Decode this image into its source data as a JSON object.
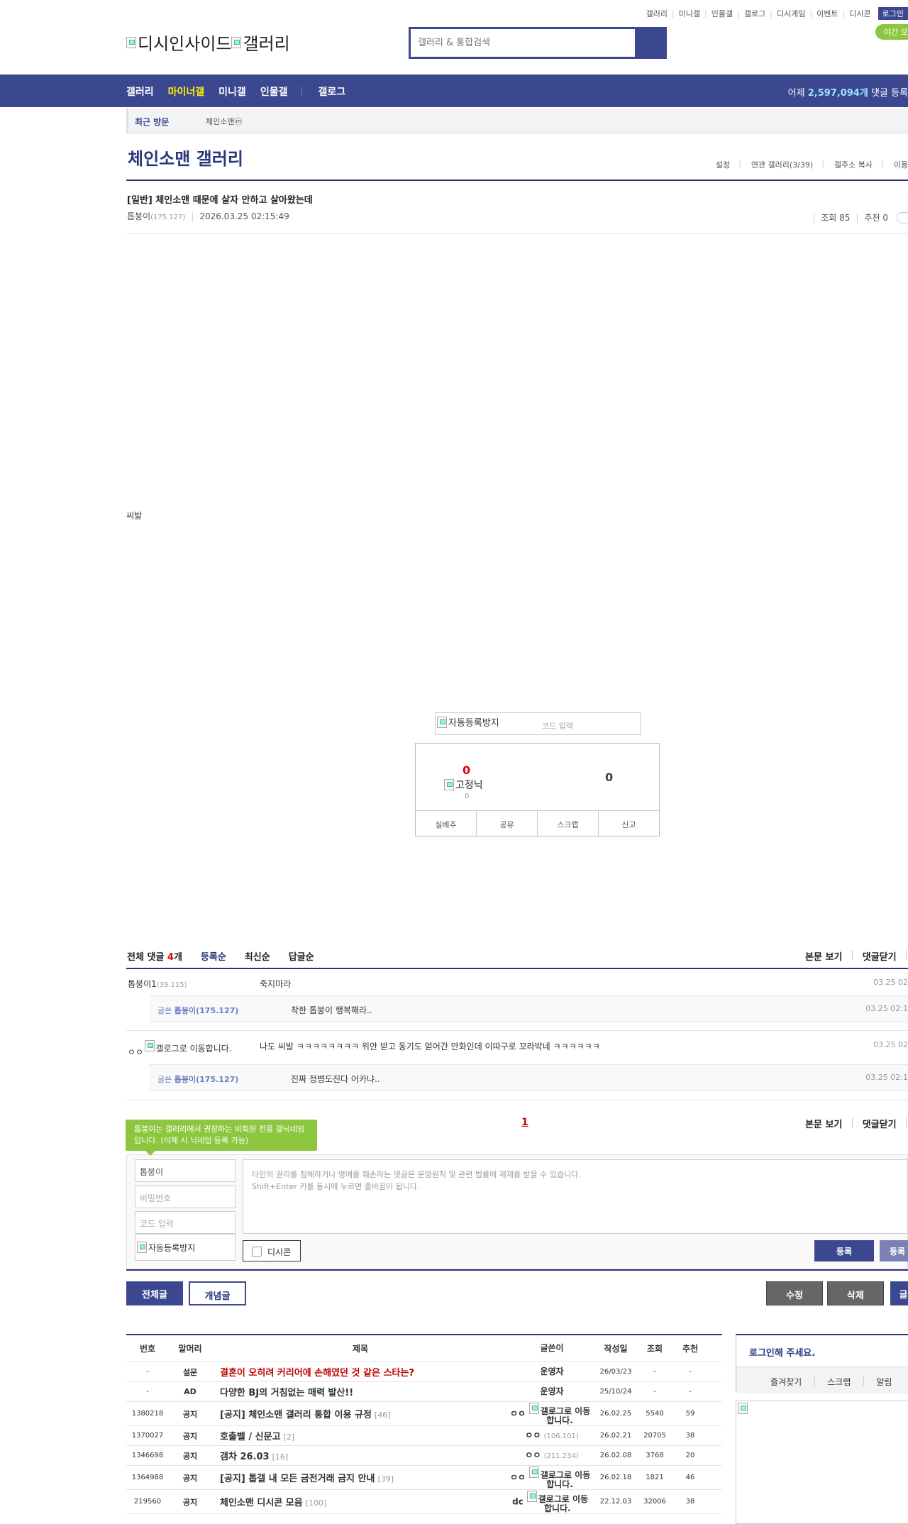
{
  "util": {
    "links": [
      "갤러리",
      "미니갤",
      "인물갤",
      "갤로그",
      "디시게임",
      "이벤트",
      "디시콘"
    ],
    "login": "로그인",
    "night": "야간 모"
  },
  "logo": {
    "alt1": "디시인사이드",
    "alt2": "갤러리"
  },
  "search": {
    "placeholder": "갤러리 & 통합검색"
  },
  "nav": {
    "items": [
      "갤러리",
      "마이너갤",
      "미니갤",
      "인물갤",
      "갤로그"
    ],
    "stat_prefix": "어제 ",
    "stat_count": "2,597,094개",
    "stat_suffix": " 댓글 등록"
  },
  "recent": {
    "title": "최근 방문",
    "item": "체인소맨ⓜ"
  },
  "gallery": {
    "title": "체인소맨 갤러리",
    "tools": [
      "설정",
      "연관 갤러리(3/39)",
      "갤주소 복사",
      "이용"
    ]
  },
  "post": {
    "title": "[일반] 체인소맨 때문에 살자 안하고 살아왔는데",
    "author": "톱붕이",
    "ip": "(175.127)",
    "date": "2026.03.25 02:15:49",
    "views": "조회 85",
    "recommend": "추천 0",
    "body": "씨발"
  },
  "captcha": {
    "img": "자동등록방지",
    "input": "코드 입력"
  },
  "reco": {
    "up": "0",
    "fixed": "고정닉",
    "fixed_count": "0",
    "down": "0",
    "buttons": [
      "실베추",
      "공유",
      "스크랩",
      "신고"
    ]
  },
  "comments": {
    "total_label": "전체 댓글 ",
    "total_count": "4",
    "total_unit": "개",
    "sorts": [
      "등록순",
      "최신순",
      "답글순"
    ],
    "right": [
      "본문 보기",
      "댓글닫기"
    ],
    "rows": [
      {
        "nick": "톱붕이1",
        "ip": "(39.115)",
        "text": "죽지마라",
        "date": "03.25 02"
      },
      {
        "nick": "ㅇㅇ",
        "img": "갤로그로 이동합니다.",
        "text": "나도 씨발 ㅋㅋㅋㅋㅋㅋㅋㅋ 위안 받고 동기도 얻어간 만화인데 이따구로 꼬라박네 ㅋㅋㅋㅋㅋㅋ",
        "date": "03.25 02"
      }
    ],
    "replies": [
      {
        "prefix": "글쓴 ",
        "nick": "톱붕이",
        "ip": "(175.127)",
        "text": "착한 톱붕이 행복해라..",
        "date": "03.25 02:1"
      },
      {
        "prefix": "글쓴 ",
        "nick": "톱붕이",
        "ip": "(175.127)",
        "text": "진짜 정병도진다 어카냐..",
        "date": "03.25 02:1"
      }
    ],
    "page": "1"
  },
  "write": {
    "tooltip": "톱붕이는 갤러리에서 권장하는 비회원 전용 갤닉네임입니다. (삭제 시 닉네임 등록 가능)",
    "nick": "톱붕이",
    "password": "비밀번호",
    "code": "코드 입력",
    "captcha": "자동등록방지",
    "textarea": "타인의 권리를 침해하거나 명예를 훼손하는 댓글은 운영원칙 및 관련 법률에 제재를 받을 수 있습니다.\nShift+Enter 키를 동시에 누르면 줄바꿈이 됩니다.",
    "dccon": "디시콘",
    "register": "등록",
    "register2": "등록"
  },
  "actions": {
    "all": "전체글",
    "concept": "개념글",
    "edit": "수정",
    "delete": "삭제",
    "more": "글"
  },
  "list": {
    "headers": [
      "번호",
      "말머리",
      "제목",
      "글쓴이",
      "작성일",
      "조회",
      "추천"
    ],
    "rows": [
      {
        "no": "-",
        "sub": "설문",
        "title": "결혼이 오히려 커리어에 손해였던 것 같은 스타는?",
        "rc": "",
        "writer": "운영자",
        "ip": "",
        "img": "",
        "date": "26/03/23",
        "views": "-",
        "rec": "-",
        "red": true
      },
      {
        "no": "-",
        "sub": "AD",
        "title": "다양한 BJ의 거침없는 매력 발산!!",
        "rc": "",
        "writer": "운영자",
        "ip": "",
        "img": "",
        "date": "25/10/24",
        "views": "-",
        "rec": "-",
        "red": false
      },
      {
        "no": "1380218",
        "sub": "공지",
        "title": "[공지] 체인소맨 갤러리 통합 이용 규정",
        "rc": "[46]",
        "writer": "ㅇㅇ",
        "ip": "",
        "img": "갤로그로 이동합니다.",
        "date": "26.02.25",
        "views": "5540",
        "rec": "59",
        "red": false
      },
      {
        "no": "1370027",
        "sub": "공지",
        "title": "호출벨 / 신문고",
        "rc": "[2]",
        "writer": "ㅇㅇ",
        "ip": "(106.101)",
        "img": "",
        "date": "26.02.21",
        "views": "20705",
        "rec": "38",
        "red": false
      },
      {
        "no": "1346698",
        "sub": "공지",
        "title": "갬차 26.03",
        "rc": "[16]",
        "writer": "ㅇㅇ",
        "ip": "(211.234)",
        "img": "",
        "date": "26.02.08",
        "views": "3768",
        "rec": "20",
        "red": false
      },
      {
        "no": "1364988",
        "sub": "공지",
        "title": "[공지] 톱갤 내 모든 금전거래 금지 안내",
        "rc": "[39]",
        "writer": "ㅇㅇ",
        "ip": "",
        "img": "갤로그로 이동합니다.",
        "date": "26.02.18",
        "views": "1821",
        "rec": "46",
        "red": false
      },
      {
        "no": "219560",
        "sub": "공지",
        "title": "체인소맨 디시콘 모음",
        "rc": "[100]",
        "writer": "dc",
        "ip": "",
        "img": "갤로그로 이동합니다.",
        "date": "22.12.03",
        "views": "32006",
        "rec": "38",
        "red": false
      }
    ]
  },
  "loginbox": {
    "title": "로그인해 주세요.",
    "links": [
      "즐겨찾기",
      "스크랩",
      "알림"
    ]
  }
}
